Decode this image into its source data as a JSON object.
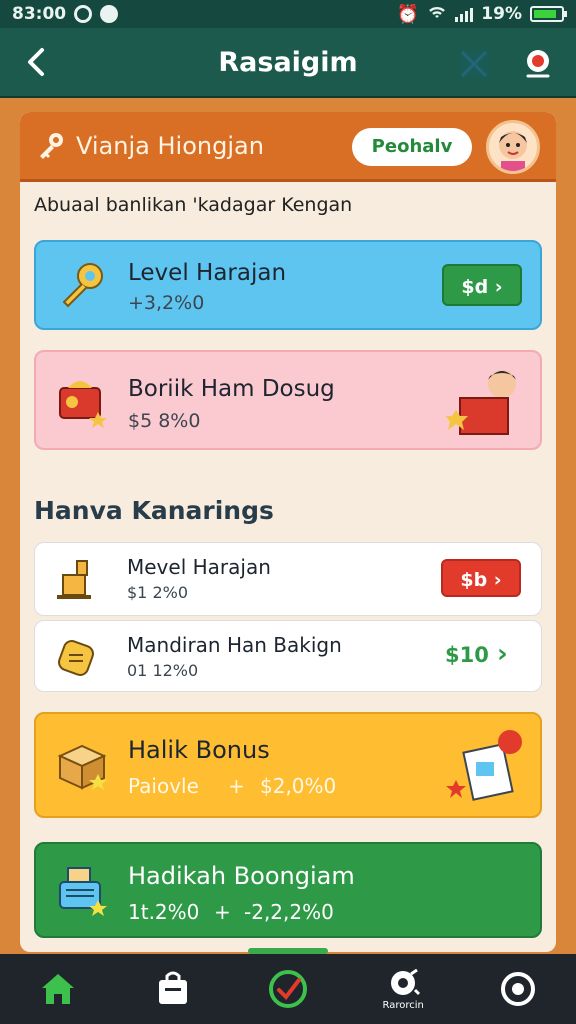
{
  "status_bar": {
    "time": "83:00",
    "battery": "19%",
    "battery_level": 0.85
  },
  "header": {
    "title": "Rasaigim"
  },
  "panel": {
    "title": "Vianja Hiongjan",
    "pill": "Peohalv"
  },
  "subtitle": "Abuaal banlikan 'kadagar Kengan",
  "cards_top": [
    {
      "title": "Level Harajan",
      "value": "+3,2%0",
      "button": "$d"
    },
    {
      "title": "Boriik Ham Dosug",
      "value": "$5 8%0"
    }
  ],
  "section": "Hanva Kanarings",
  "list": [
    {
      "title": "Mevel Harajan",
      "value": "$1 2%0",
      "button": "$b"
    },
    {
      "title": "Mandiran Han Bakign",
      "value": "01 12%0",
      "amount": "$10"
    }
  ],
  "bonus": [
    {
      "title": "Halik Bonus",
      "value_left": "Paiovle",
      "value_right": "$2,0%0"
    },
    {
      "title": "Hadikah Boongiam",
      "value_left": "1t.2%0",
      "value_right": "-2,2,2%0"
    }
  ],
  "nav": {
    "label4": "Rarorcin"
  },
  "colors": {
    "header": "#1b5a4c",
    "accent_orange": "#d96f25",
    "green": "#2e9a48",
    "blue": "#5ec5f0",
    "pink": "#fbc9d0",
    "yellow": "#ffbd32",
    "red": "#e23b2b"
  }
}
